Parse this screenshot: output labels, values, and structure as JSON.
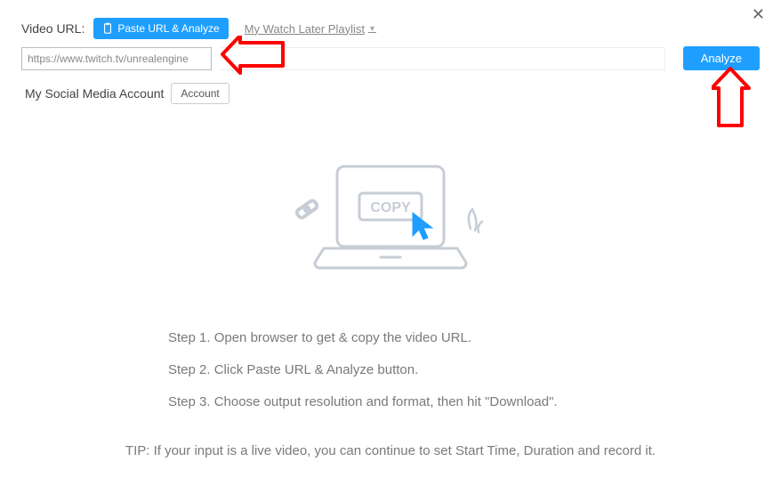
{
  "header": {
    "video_url_label": "Video URL:",
    "paste_button": "Paste URL & Analyze",
    "playlist_link": "My Watch Later Playlist"
  },
  "url_input": {
    "value": "https://www.twitch.tv/unrealengine"
  },
  "analyze_button": "Analyze",
  "account": {
    "label": "My Social Media Account",
    "button": "Account"
  },
  "illustration": {
    "copy_label": "COPY"
  },
  "steps": {
    "s1": "Step 1. Open browser to get & copy the video URL.",
    "s2": "Step 2. Click Paste URL & Analyze button.",
    "s3": "Step 3. Choose output resolution and format, then hit \"Download\"."
  },
  "tip": "TIP: If your input is a live video, you can continue to set Start Time, Duration and record it."
}
